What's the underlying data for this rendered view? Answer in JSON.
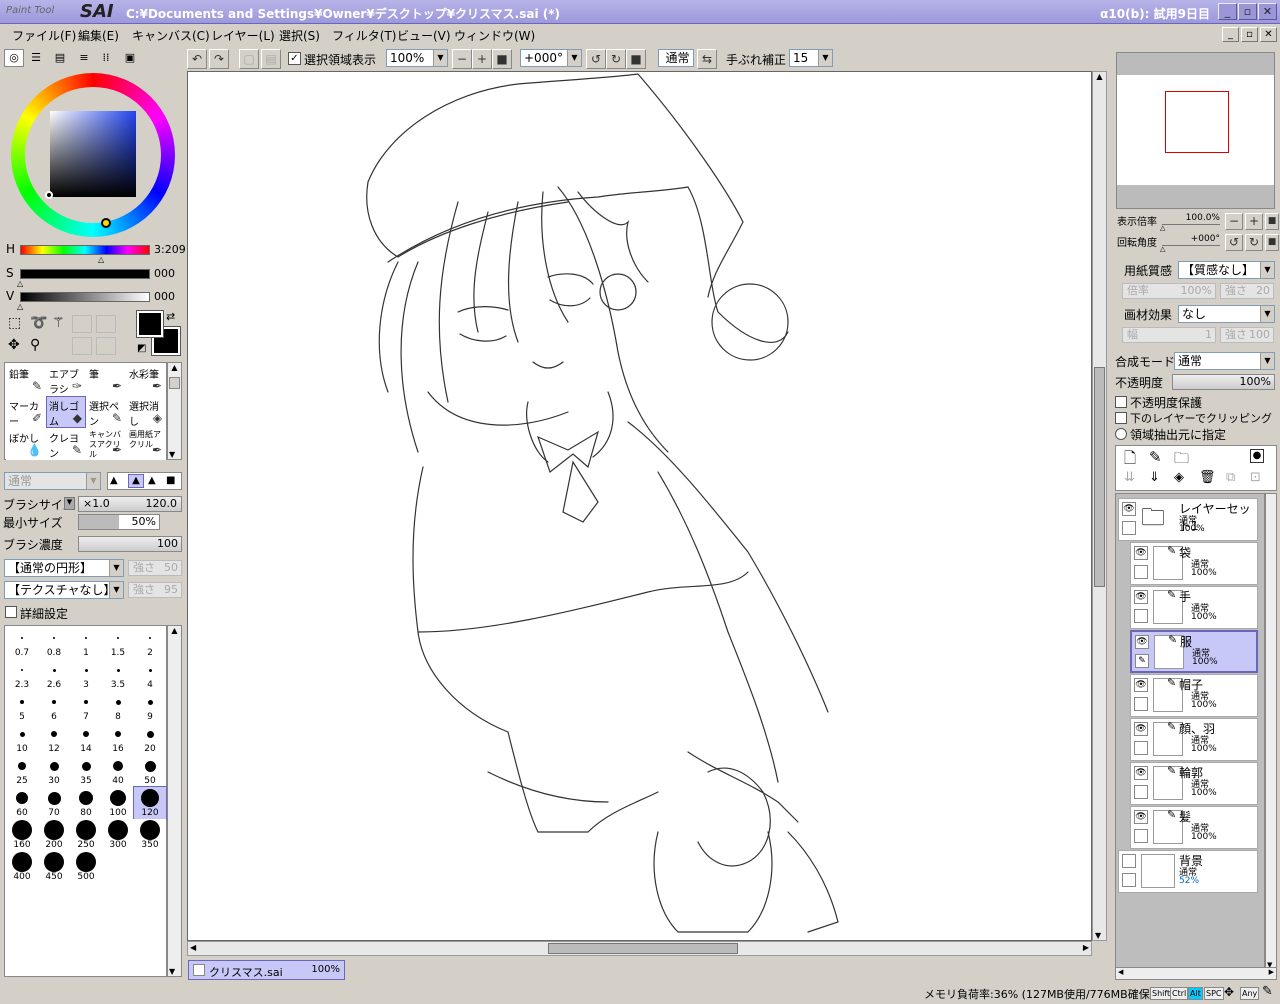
{
  "app": {
    "logo_small": "Paint Tool",
    "logo_big": "SAI",
    "title": "C:¥Documents and Settings¥Owner¥デスクトップ¥クリスマス.sai (*)",
    "trial": "α10(b): 試用9日目"
  },
  "menu": [
    "ファイル(F)",
    "編集(E)",
    "キャンバス(C)",
    "レイヤー(L)",
    "選択(S)",
    "フィルタ(T)",
    "ビュー(V)",
    "ウィンドウ(W)"
  ],
  "toolbar": {
    "show_selection_label": "選択領域表示",
    "show_selection_checked": true,
    "zoom": "100%",
    "rotation": "+000°",
    "blend": "通常",
    "stabilizer_label": "手ぶれ補正",
    "stabilizer_value": "15"
  },
  "color": {
    "h_label": "H",
    "h_value": "3:209",
    "s_label": "S",
    "s_value": "000",
    "v_label": "V",
    "v_value": "000",
    "primary": "#000000",
    "secondary": "#000000"
  },
  "tools": [
    {
      "label": "鉛筆",
      "icon": "pencil-icon"
    },
    {
      "label": "エアブラシ",
      "icon": "airbrush-icon"
    },
    {
      "label": "筆",
      "icon": "brush-icon"
    },
    {
      "label": "水彩筆",
      "icon": "watercolor-icon"
    },
    {
      "label": "マーカー",
      "icon": "marker-icon"
    },
    {
      "label": "消しゴム",
      "icon": "eraser-icon",
      "selected": true
    },
    {
      "label": "選択ペン",
      "icon": "selection-pen-icon"
    },
    {
      "label": "選択消し",
      "icon": "selection-eraser-icon"
    },
    {
      "label": "ぼかし",
      "icon": "blur-icon"
    },
    {
      "label": "クレヨン",
      "icon": "crayon-icon"
    },
    {
      "label": "キャンバスアクリル",
      "icon": "canvas-acrylic-icon"
    },
    {
      "label": "画用紙アクリル",
      "icon": "paper-acrylic-icon"
    }
  ],
  "brush": {
    "mode": "通常",
    "size_label": "ブラシサイズ",
    "size_mult": "×1.0",
    "size_value": "120.0",
    "min_size_label": "最小サイズ",
    "min_size_value": "50%",
    "density_label": "ブラシ濃度",
    "density_value": "100",
    "shape": "【通常の円形】",
    "shape_strength_label": "強さ",
    "shape_strength": "50",
    "texture": "【テクスチャなし】",
    "texture_strength_label": "強さ",
    "texture_strength": "95",
    "detail_label": "詳細設定",
    "presets": [
      "0.7",
      "0.8",
      "1",
      "1.5",
      "2",
      "2.3",
      "2.6",
      "3",
      "3.5",
      "4",
      "5",
      "6",
      "7",
      "8",
      "9",
      "10",
      "12",
      "14",
      "16",
      "20",
      "25",
      "30",
      "35",
      "40",
      "50",
      "60",
      "70",
      "80",
      "100",
      "120",
      "160",
      "200",
      "250",
      "300",
      "350",
      "400",
      "450",
      "500"
    ],
    "selected_preset": "120"
  },
  "navigator": {
    "zoom_label": "表示倍率",
    "zoom_value": "100.0%",
    "rotate_label": "回転角度",
    "rotate_value": "+000°"
  },
  "paper": {
    "texture_label": "用紙質感",
    "texture_value": "【質感なし】",
    "texture_scale_label": "倍率",
    "texture_scale": "100%",
    "texture_strength_label": "強さ",
    "texture_strength": "20",
    "effect_label": "画材効果",
    "effect_value": "なし",
    "effect_width_label": "幅",
    "effect_width": "1",
    "effect_strength_label": "強さ",
    "effect_strength": "100"
  },
  "layer_props": {
    "blend_label": "合成モード",
    "blend_value": "通常",
    "opacity_label": "不透明度",
    "opacity_value": "100%",
    "preserve_opacity": "不透明度保護",
    "clip_label": "下のレイヤーでクリッピング",
    "selection_source": "領域抽出元に指定"
  },
  "layers": [
    {
      "name": "レイヤーセット1",
      "mode": "通常",
      "opacity": "100%",
      "type": "folder"
    },
    {
      "name": "袋",
      "mode": "通常",
      "opacity": "100%",
      "type": "pen"
    },
    {
      "name": "手",
      "mode": "通常",
      "opacity": "100%",
      "type": "pen"
    },
    {
      "name": "服",
      "mode": "通常",
      "opacity": "100%",
      "type": "pen",
      "selected": true
    },
    {
      "name": "帽子",
      "mode": "通常",
      "opacity": "100%",
      "type": "pen"
    },
    {
      "name": "顔、羽",
      "mode": "通常",
      "opacity": "100%",
      "type": "pen"
    },
    {
      "name": "輪郭",
      "mode": "通常",
      "opacity": "100%",
      "type": "pen"
    },
    {
      "name": "髪",
      "mode": "通常",
      "opacity": "100%",
      "type": "pen"
    },
    {
      "name": "背景",
      "mode": "通常",
      "opacity": "52%",
      "type": "bg"
    }
  ],
  "document_tab": {
    "name": "クリスマス.sai",
    "zoom": "100%"
  },
  "status": {
    "memory": "メモリ負荷率:36% (127MB使用/776MB確保)",
    "keys": [
      "Shift",
      "Ctrl",
      "Alt",
      "SPC",
      "Any"
    ]
  },
  "colors": {
    "titlebar": "#9c98dc",
    "selection": "#c8c8f8",
    "accent": "#6a66b8"
  }
}
